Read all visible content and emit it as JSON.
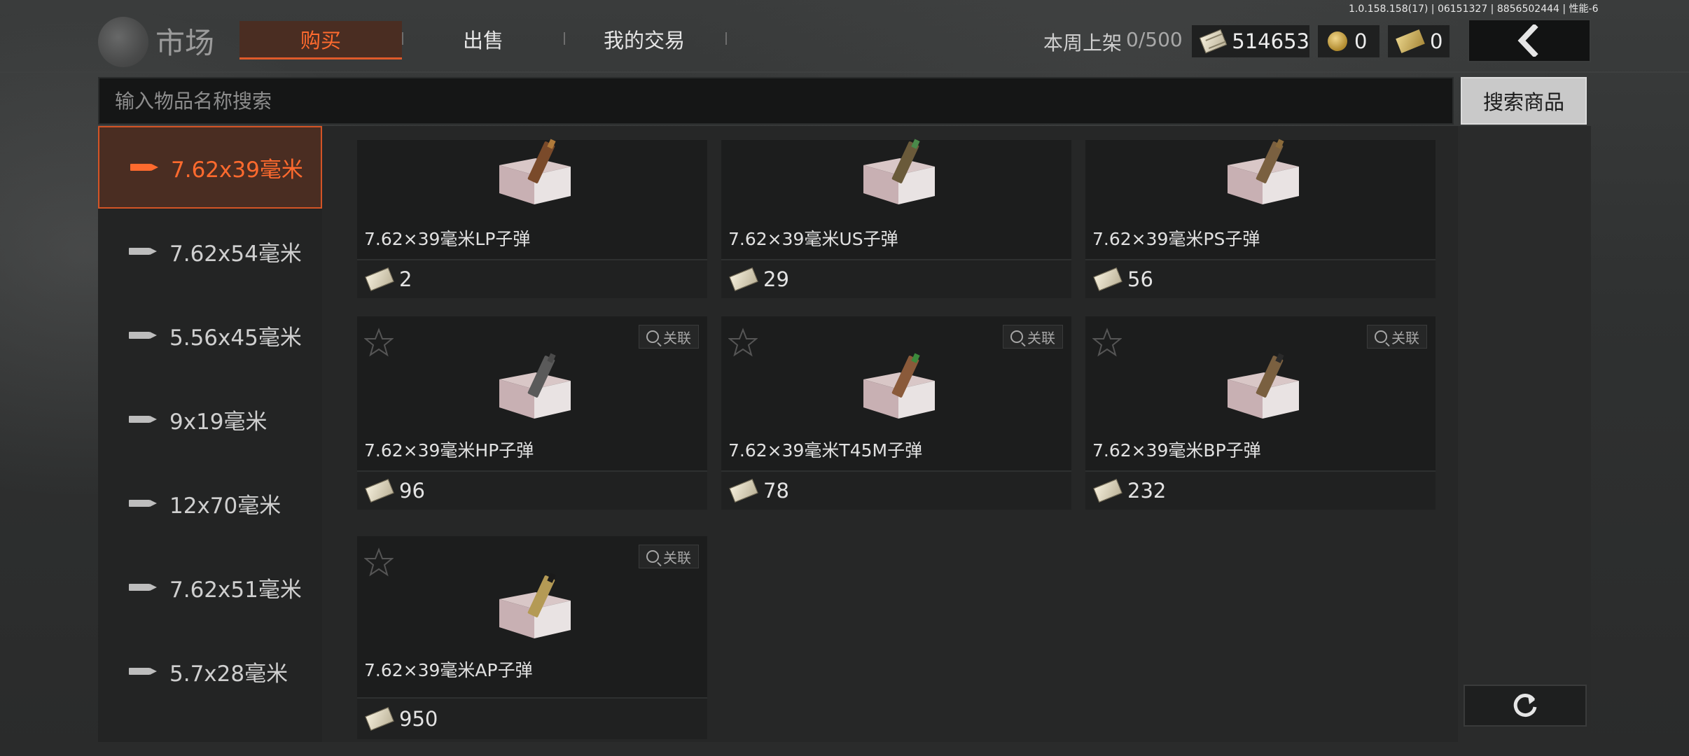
{
  "build_info": "1.0.158.158(17) | 06151327 | 8856502444 | 性能-6",
  "header": {
    "title": "市场",
    "tabs": [
      {
        "label": "购买",
        "active": true
      },
      {
        "label": "出售",
        "active": false
      },
      {
        "label": "我的交易",
        "active": false
      }
    ],
    "weekly_label": "本周上架",
    "weekly_count": "0/500",
    "currencies": [
      {
        "icon": "cash-icon",
        "value": "514653"
      },
      {
        "icon": "coin-icon",
        "value": "0"
      },
      {
        "icon": "ticket-icon",
        "value": "0"
      }
    ],
    "back_icon": "chevron-left-icon"
  },
  "search": {
    "placeholder": "输入物品名称搜索",
    "value": "",
    "button_label": "搜索商品"
  },
  "categories": [
    {
      "label": "7.62x39毫米",
      "active": true
    },
    {
      "label": "7.62x54毫米",
      "active": false
    },
    {
      "label": "5.56x45毫米",
      "active": false
    },
    {
      "label": "9x19毫米",
      "active": false
    },
    {
      "label": "12x70毫米",
      "active": false
    },
    {
      "label": "7.62x51毫米",
      "active": false
    },
    {
      "label": "5.7x28毫米",
      "active": false
    }
  ],
  "items": [
    {
      "name": "7.62×39毫米LP子弹",
      "price": "2",
      "tip": "#b07a3a",
      "case": "#7a4a2a"
    },
    {
      "name": "7.62×39毫米US子弹",
      "price": "29",
      "tip": "#4a8a4a",
      "case": "#6a5a3a"
    },
    {
      "name": "7.62×39毫米PS子弹",
      "price": "56",
      "tip": "#8a6a3a",
      "case": "#7a6040"
    },
    {
      "name": "7.62×39毫米HP子弹",
      "price": "96",
      "tip": "#4a4a4a",
      "case": "#5a5a5a",
      "related_label": "关联"
    },
    {
      "name": "7.62×39毫米T45M子弹",
      "price": "78",
      "tip": "#3c8a3c",
      "case": "#8a5a3a",
      "related_label": "关联"
    },
    {
      "name": "7.62×39毫米BP子弹",
      "price": "232",
      "tip": "#2a2a2a",
      "case": "#7a6040",
      "related_label": "关联"
    },
    {
      "name": "7.62×39毫米AP子弹",
      "price": "950",
      "tip": "#1a1a1a",
      "case": "#b49a55",
      "related_label": "关联"
    }
  ],
  "refresh_icon": "refresh-icon",
  "colors": {
    "accent": "#ff6a2e",
    "active_bg": "#4a2d22"
  }
}
